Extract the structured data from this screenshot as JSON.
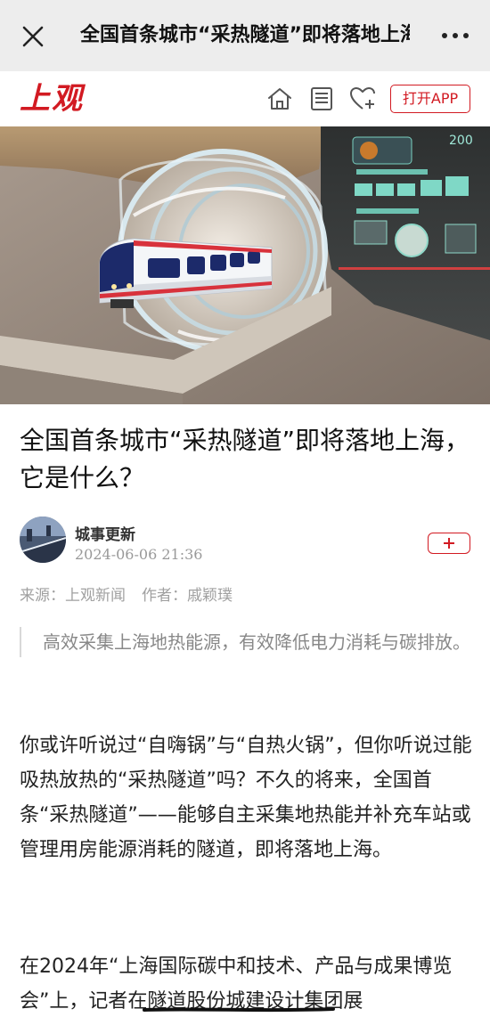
{
  "topbar": {
    "title": "全国首条城市“采热隧道”即将落地上海，它是什么？",
    "close_icon": "close-icon",
    "more_icon": "more-dots-icon"
  },
  "brandbar": {
    "logo_text": "上观",
    "home_icon": "home-icon",
    "news_icon": "newspaper-icon",
    "favorite_icon": "heart-plus-icon",
    "open_app_label": "打开APP",
    "brand_color": "#d21a22"
  },
  "article": {
    "headline": "全国首条城市“采热隧道”即将落地上海，它是什么？",
    "author": {
      "name": "城事更新",
      "time": "2024-06-06 21:36",
      "follow_icon": "plus-icon"
    },
    "meta": {
      "source": "来源：上观新闻",
      "writer": "作者：戚颖璞"
    },
    "summary": "高效采集上海地热能源，有效降低电力消耗与碳排放。",
    "paragraphs": [
      "你或许听说过“自嗨锅”与“自热火锅”，但你听说过能吸热放热的“采热隧道”吗？不久的将来，全国首条“采热隧道”——能够自主采集地热能并补充车站或管理用房能源消耗的隧道，即将落地上海。",
      "在2024年“上海国际碳中和技术、产品与成果博览会”上，记者在隧道股份城建设计集团展"
    ]
  }
}
